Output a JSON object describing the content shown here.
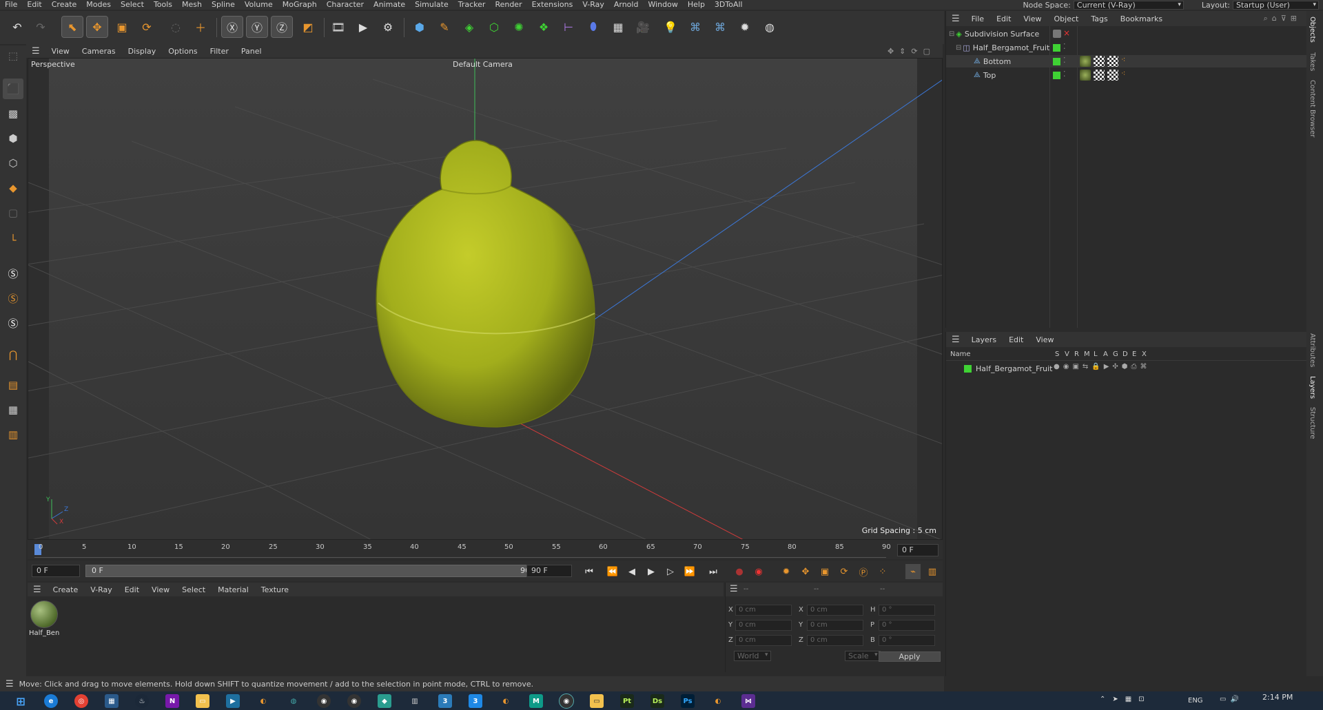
{
  "menubar": {
    "items": [
      "File",
      "Edit",
      "Create",
      "Modes",
      "Select",
      "Tools",
      "Mesh",
      "Spline",
      "Volume",
      "MoGraph",
      "Character",
      "Animate",
      "Simulate",
      "Tracker",
      "Render",
      "Extensions",
      "V-Ray",
      "Arnold",
      "Window",
      "Help",
      "3DToAll"
    ],
    "node_space_label": "Node Space:",
    "node_space_value": "Current (V-Ray)",
    "layout_label": "Layout:",
    "layout_value": "Startup (User)"
  },
  "viewport": {
    "menu": [
      "View",
      "Cameras",
      "Display",
      "Options",
      "Filter",
      "Panel"
    ],
    "projection": "Perspective",
    "camera": "Default Camera",
    "grid_spacing": "Grid Spacing : 5 cm",
    "axis_y": "Y",
    "axis_z": "Z",
    "axis_x": "X"
  },
  "timeline": {
    "ticks": [
      "0",
      "5",
      "10",
      "15",
      "20",
      "25",
      "30",
      "35",
      "40",
      "45",
      "50",
      "55",
      "60",
      "65",
      "70",
      "75",
      "80",
      "85",
      "90"
    ],
    "current_frame": "0 F"
  },
  "transport": {
    "start_field": "0 F",
    "range_start": "0 F",
    "range_end": "90 F",
    "end_field": "90 F"
  },
  "material_manager": {
    "menu": [
      "Create",
      "V-Ray",
      "Edit",
      "View",
      "Select",
      "Material",
      "Texture"
    ],
    "materials": [
      {
        "name": "Half_Ben"
      }
    ]
  },
  "coordinates": {
    "header_a": "--",
    "header_b": "--",
    "header_c": "--",
    "pos_x": "0 cm",
    "pos_y": "0 cm",
    "pos_z": "0 cm",
    "size_x": "0 cm",
    "size_y": "0 cm",
    "size_z": "0 cm",
    "rot_h": "0 °",
    "rot_p": "0 °",
    "rot_b": "0 °",
    "label_x": "X",
    "label_y": "Y",
    "label_z": "Z",
    "label_h": "H",
    "label_p": "P",
    "label_b": "B",
    "mode_world": "World",
    "mode_scale": "Scale",
    "apply": "Apply"
  },
  "status_bar": {
    "text": "Move: Click and drag to move elements. Hold down SHIFT to quantize movement / add to the selection in point mode, CTRL to remove."
  },
  "object_manager": {
    "menu": [
      "File",
      "Edit",
      "View",
      "Object",
      "Tags",
      "Bookmarks"
    ],
    "objects": [
      {
        "name": "Subdivision Surface"
      },
      {
        "name": "Half_Bergamot_Fruit"
      },
      {
        "name": "Bottom"
      },
      {
        "name": "Top"
      }
    ]
  },
  "layer_manager": {
    "menu": [
      "Layers",
      "Edit",
      "View"
    ],
    "col_name": "Name",
    "columns": [
      "S",
      "V",
      "R",
      "M",
      "L",
      "A",
      "G",
      "D",
      "E",
      "X"
    ],
    "layers": [
      {
        "name": "Half_Bergamot_Fruit",
        "color": "#3fd234"
      }
    ]
  },
  "right_tabs": [
    "Objects",
    "Takes",
    "Content Browser",
    "Attributes",
    "Layers",
    "Structure"
  ],
  "taskbar": {
    "lang": "ENG",
    "time": "2:14 PM"
  },
  "colors": {
    "accent": "#e8962e",
    "fruit": "#a8b51c",
    "layer_green": "#3fd234",
    "axis_x": "#d13b3b",
    "axis_y": "#3fbf5a",
    "axis_z": "#3c78d8"
  }
}
